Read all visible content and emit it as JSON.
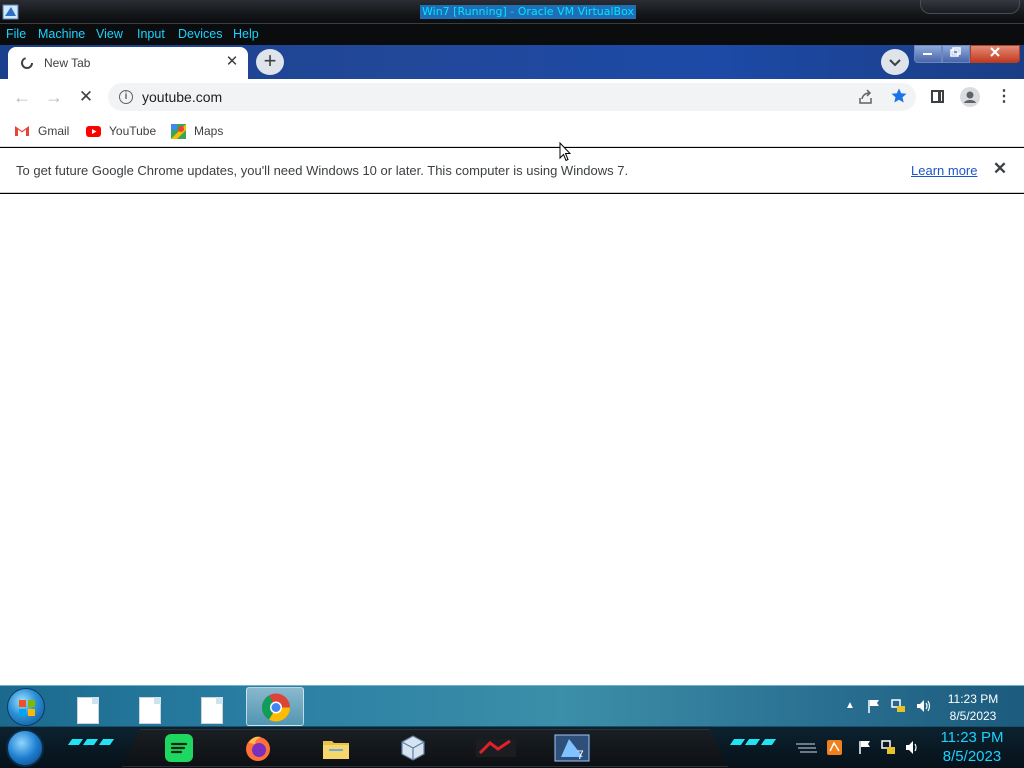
{
  "vbox": {
    "title": "Win7 [Running] - Oracle VM VirtualBox",
    "menu": [
      "File",
      "Machine",
      "View",
      "Input",
      "Devices",
      "Help"
    ]
  },
  "browser": {
    "tab": {
      "title": "New Tab"
    },
    "new_tab_symbol": "+",
    "address": "youtube.com",
    "bookmarks": [
      {
        "label": "Gmail",
        "icon": "gmail-icon"
      },
      {
        "label": "YouTube",
        "icon": "youtube-icon"
      },
      {
        "label": "Maps",
        "icon": "maps-icon"
      }
    ],
    "infobar": {
      "message": "To get future Google Chrome updates, you'll need Windows 10 or later. This computer is using Windows 7.",
      "link": "Learn more"
    },
    "accent_color": "#1a73e8"
  },
  "guest_taskbar": {
    "time": "11:23 PM",
    "date": "8/5/2023"
  },
  "host_taskbar": {
    "time": "11:23 PM",
    "date": "8/5/2023"
  }
}
